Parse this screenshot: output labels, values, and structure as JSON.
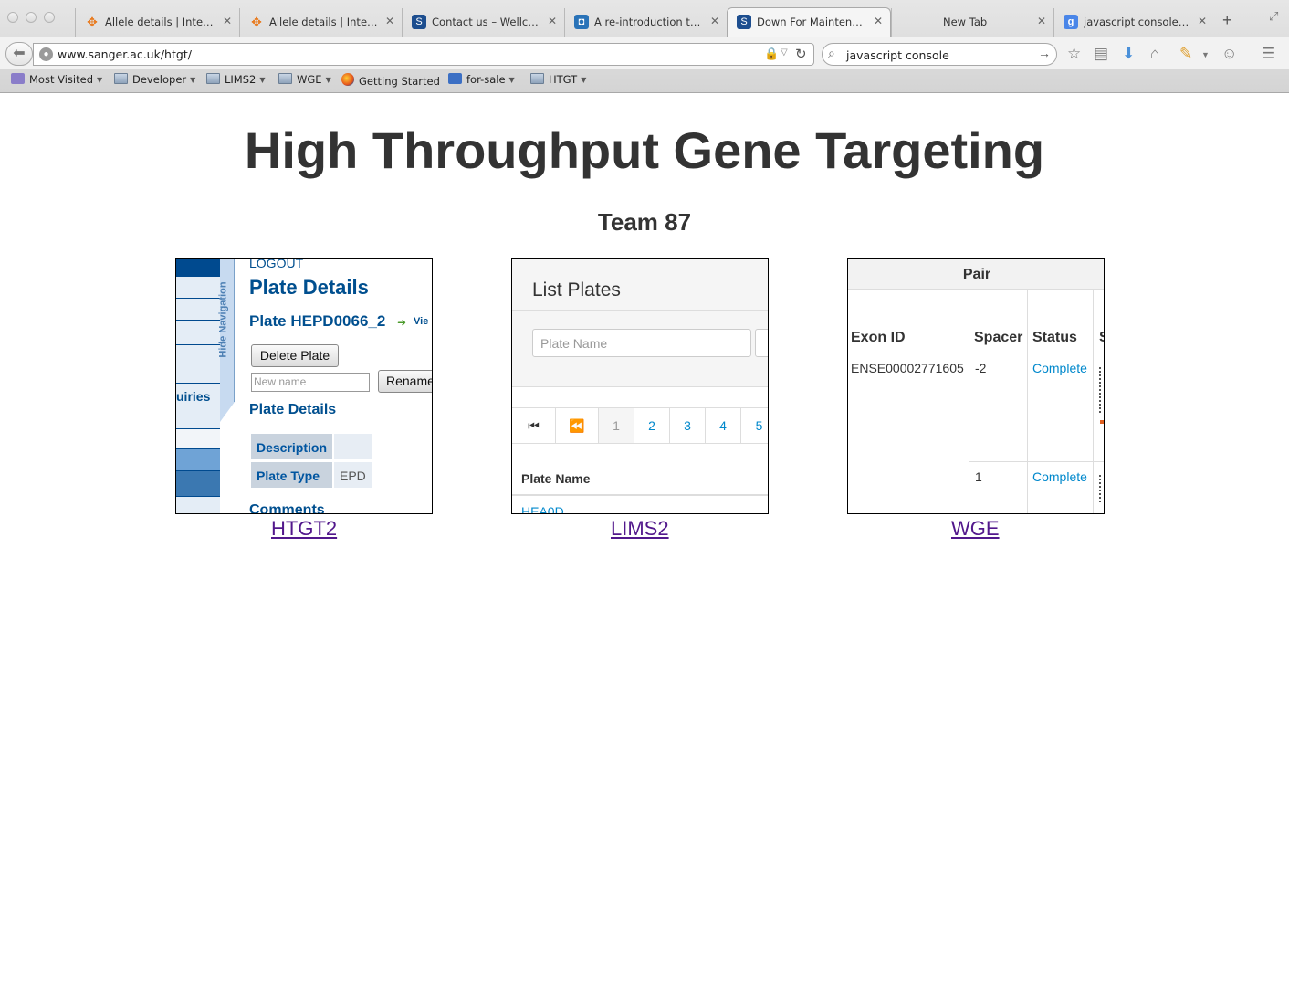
{
  "browser": {
    "tabs": [
      {
        "title": "Allele details | Inter…",
        "favicon": "ikmc-icon",
        "active": false
      },
      {
        "title": "Allele details | Inter…",
        "favicon": "ikmc-icon",
        "active": false
      },
      {
        "title": "Contact us – Wellco…",
        "favicon": "sanger-icon",
        "active": false
      },
      {
        "title": "A re-introduction to…",
        "favicon": "mdn-icon",
        "active": false
      },
      {
        "title": "Down For Maintena…",
        "favicon": "sanger-icon",
        "active": true
      },
      {
        "title": "New Tab",
        "favicon": "",
        "active": false
      },
      {
        "title": "javascript console – …",
        "favicon": "google-icon",
        "active": false
      }
    ],
    "url": "www.sanger.ac.uk/htgt/",
    "search_query": "javascript console",
    "bookmarks": [
      {
        "label": "Most Visited",
        "type": "smart",
        "dropdown": true
      },
      {
        "label": "Developer",
        "type": "folder",
        "dropdown": true
      },
      {
        "label": "LIMS2",
        "type": "folder",
        "dropdown": true
      },
      {
        "label": "WGE",
        "type": "folder",
        "dropdown": true
      },
      {
        "label": "Getting Started",
        "type": "firefox",
        "dropdown": false
      },
      {
        "label": "for-sale",
        "type": "feed",
        "dropdown": true
      },
      {
        "label": "HTGT",
        "type": "folder",
        "dropdown": true
      }
    ]
  },
  "page": {
    "title": "High Throughput Gene Targeting",
    "subtitle": "Team 87",
    "apps": [
      {
        "name": "HTGT2"
      },
      {
        "name": "LIMS2"
      },
      {
        "name": "WGE"
      }
    ]
  },
  "thumbs": {
    "htgt2": {
      "logout": "LOGOUT",
      "heading": "Plate Details",
      "plate": "Plate HEPD0066_2",
      "view": "Vie",
      "hide_nav": "Hide Navigation",
      "nav_partial": "uiries",
      "delete_btn": "Delete Plate",
      "new_name_placeholder": "New name",
      "rename_btn": "Rename",
      "section": "Plate Details",
      "description_label": "Description",
      "plate_type_label": "Plate Type",
      "plate_type_value": "EPD",
      "comments": "Comments"
    },
    "lims2": {
      "heading": "List Plates",
      "search_placeholder": "Plate Name",
      "pages": [
        "1",
        "2",
        "3",
        "4",
        "5"
      ],
      "col_header": "Plate Name",
      "first_row": "HEA0D"
    },
    "wge": {
      "group_header": "Pair",
      "col_exon": "Exon ID",
      "col_spacer": "Spacer",
      "col_status": "Status",
      "col_partial": "S",
      "row1_exon": "ENSE00002771605",
      "row1_spacer": "-2",
      "row1_status": "Complete",
      "row2_spacer": "1",
      "row2_status": "Complete"
    }
  }
}
